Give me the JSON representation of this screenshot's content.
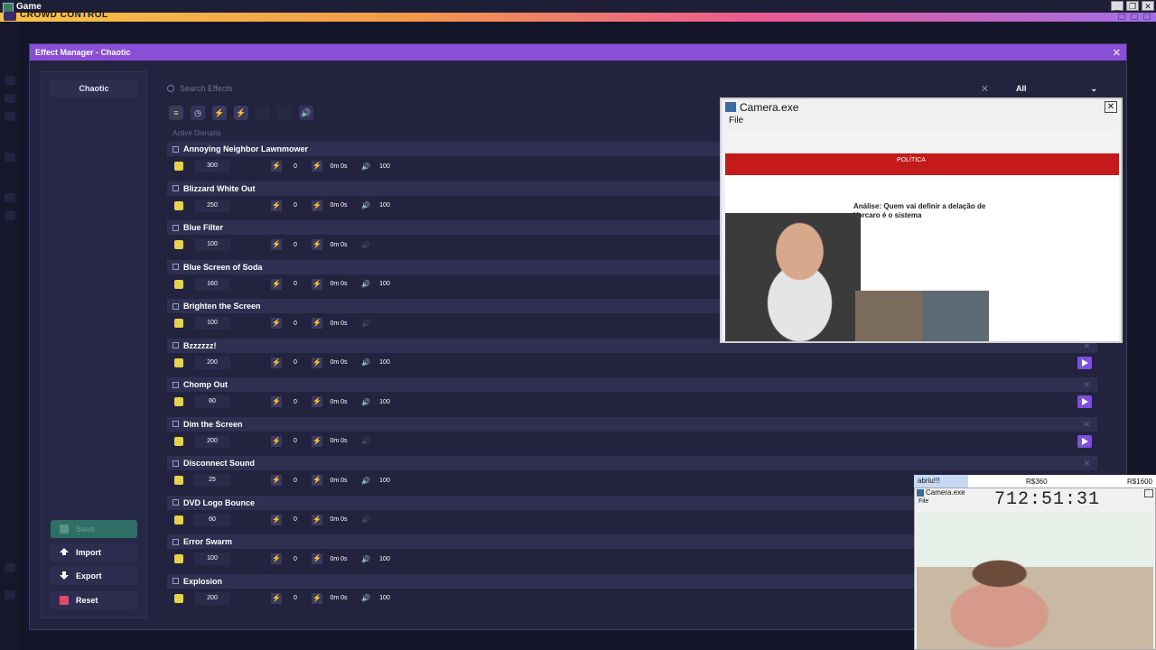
{
  "os": {
    "title": "Game",
    "controls": [
      "_",
      "❐",
      "✕"
    ]
  },
  "app": {
    "title": "CROWD CONTROL"
  },
  "dialog": {
    "title": "Effect Manager - Chaotic",
    "close": "✕"
  },
  "sidebar": {
    "profile": "Chaotic",
    "save": "Save",
    "import": "Import",
    "export": "Export",
    "reset": "Reset"
  },
  "search": {
    "placeholder": "Search Effects",
    "clear": "✕"
  },
  "filter": {
    "selected": "All"
  },
  "section": {
    "label": "Active Disrupts"
  },
  "effects": [
    {
      "name": "Annoying Neighbor Lawnmower",
      "cost": "300",
      "n": "0",
      "dur": "0m 0s",
      "vol": "100",
      "has_vol": true,
      "play": false
    },
    {
      "name": "Blizzard White Out",
      "cost": "250",
      "n": "0",
      "dur": "0m 0s",
      "vol": "100",
      "has_vol": true,
      "play": false
    },
    {
      "name": "Blue Filter",
      "cost": "100",
      "n": "0",
      "dur": "0m 0s",
      "vol": "",
      "has_vol": false,
      "play": false
    },
    {
      "name": "Blue Screen of Soda",
      "cost": "160",
      "n": "0",
      "dur": "0m 0s",
      "vol": "100",
      "has_vol": true,
      "play": false
    },
    {
      "name": "Brighten the Screen",
      "cost": "100",
      "n": "0",
      "dur": "0m 0s",
      "vol": "",
      "has_vol": false,
      "play": false
    },
    {
      "name": "Bzzzzzz!",
      "cost": "200",
      "n": "0",
      "dur": "0m 0s",
      "vol": "100",
      "has_vol": true,
      "play": true
    },
    {
      "name": "Chomp Out",
      "cost": "60",
      "n": "0",
      "dur": "0m 0s",
      "vol": "100",
      "has_vol": true,
      "play": true
    },
    {
      "name": "Dim the Screen",
      "cost": "200",
      "n": "0",
      "dur": "0m 0s",
      "vol": "",
      "has_vol": false,
      "play": true
    },
    {
      "name": "Disconnect Sound",
      "cost": "25",
      "n": "0",
      "dur": "0m 0s",
      "vol": "100",
      "has_vol": true,
      "play": false
    },
    {
      "name": "DVD Logo Bounce",
      "cost": "60",
      "n": "0",
      "dur": "0m 0s",
      "vol": "",
      "has_vol": false,
      "play": false
    },
    {
      "name": "Error Swarm",
      "cost": "100",
      "n": "0",
      "dur": "0m 0s",
      "vol": "100",
      "has_vol": true,
      "play": false
    },
    {
      "name": "Explosion",
      "cost": "200",
      "n": "0",
      "dur": "0m 0s",
      "vol": "100",
      "has_vol": true,
      "play": false
    }
  ],
  "camera": {
    "title": "Camera.exe",
    "menu": "File",
    "close": "✕",
    "article": "Análise: Quem vai definir a delação de Vorcaro é o sistema",
    "site": "POLÍTICA"
  },
  "camera2": {
    "tab": "abriu!!!",
    "price1": "R$360",
    "price2": "R$1600",
    "title": "Camera.exe",
    "menu": "File",
    "timer": "712:51:31",
    "close": "✕"
  }
}
